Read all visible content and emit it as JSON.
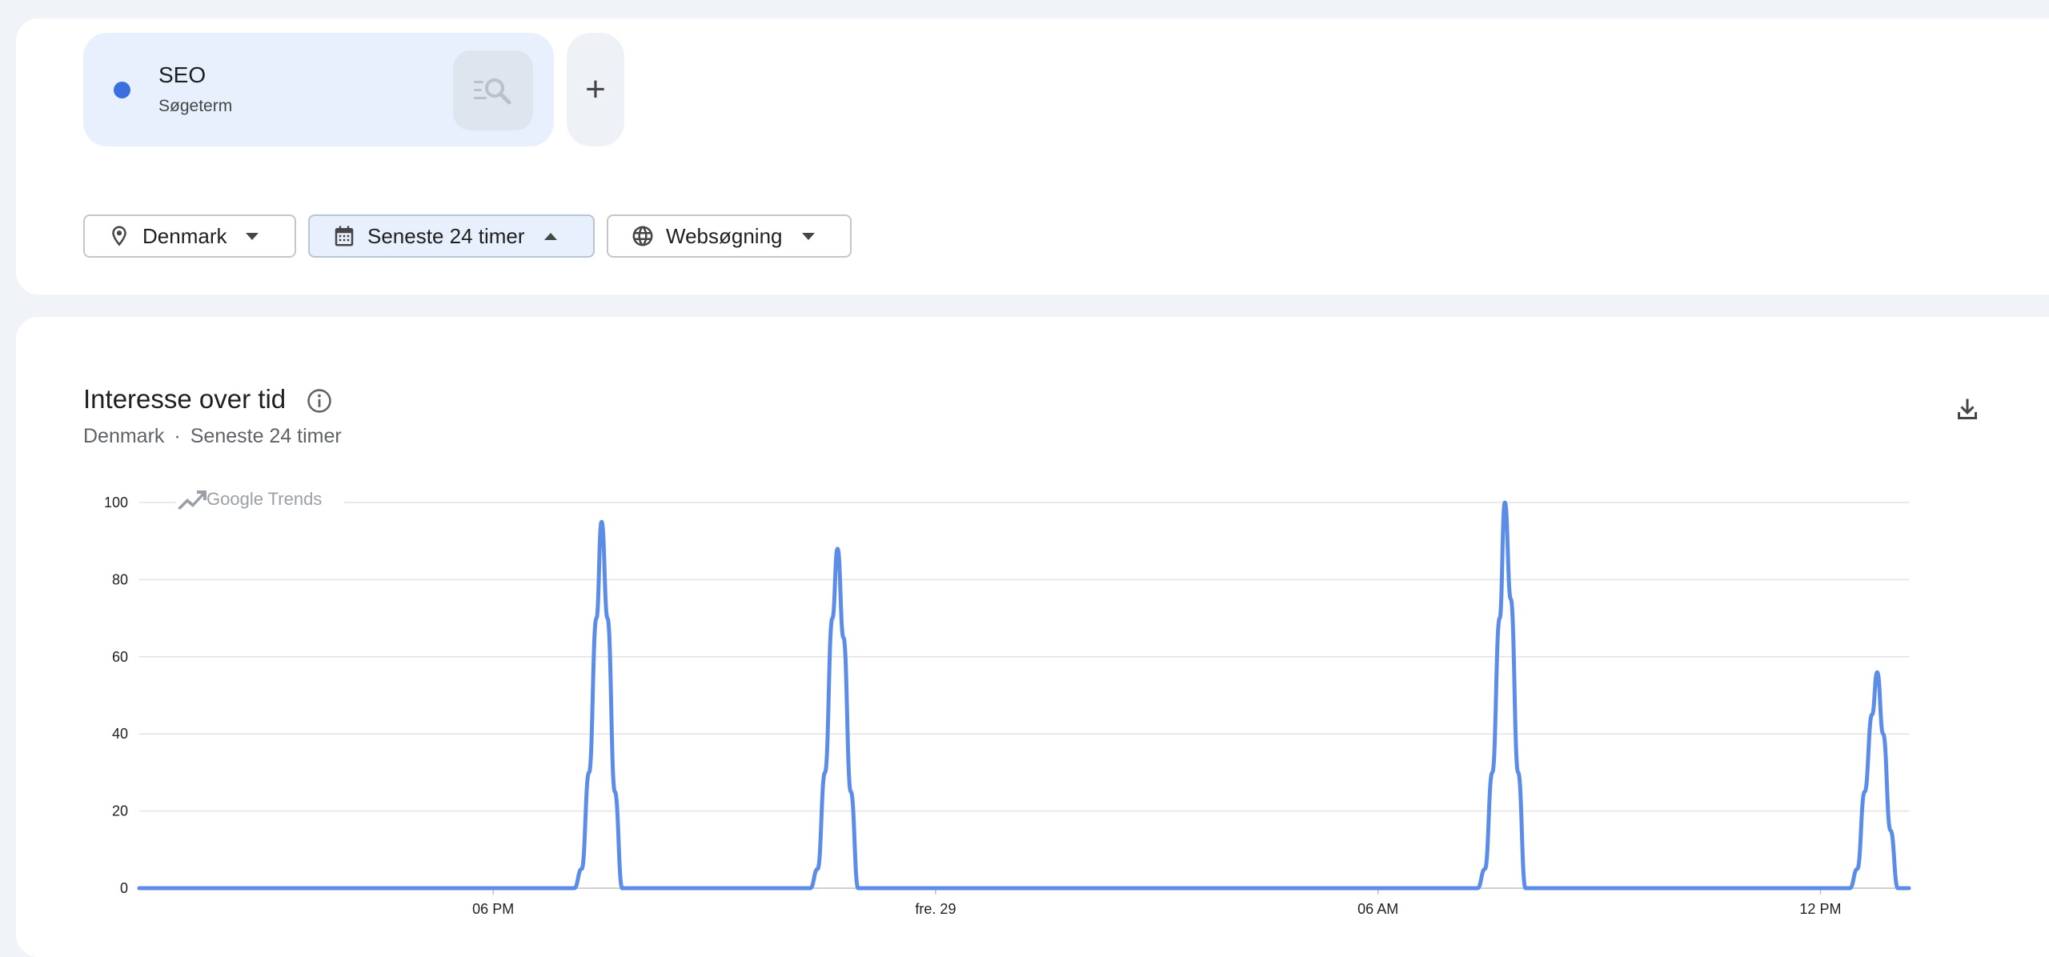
{
  "term": {
    "name": "SEO",
    "type": "Søgeterm",
    "color": "#3a6fe0",
    "search_icon": "search-list-icon",
    "add_label": "+"
  },
  "filters": {
    "location": {
      "label": "Denmark",
      "icon": "location-pin-icon"
    },
    "time": {
      "label": "Seneste 24 timer",
      "icon": "calendar-icon",
      "expanded": true
    },
    "type": {
      "label": "Websøgning",
      "icon": "globe-icon"
    }
  },
  "chart_card": {
    "title": "Interesse over tid",
    "subtitle_location": "Denmark",
    "subtitle_separator": "·",
    "subtitle_time": "Seneste 24 timer",
    "watermark": "Google Trends"
  },
  "chart_data": {
    "type": "line",
    "title": "Interesse over tid",
    "xlabel": "",
    "ylabel": "",
    "ylim": [
      0,
      100
    ],
    "yticks": [
      0,
      20,
      40,
      60,
      80,
      100
    ],
    "x_range_hours": [
      0,
      24
    ],
    "xticks": [
      {
        "label": "06 PM",
        "x": 4.8
      },
      {
        "label": "fre. 29",
        "x": 10.8
      },
      {
        "label": "06 AM",
        "x": 16.8
      },
      {
        "label": "12 PM",
        "x": 22.8
      }
    ],
    "grid": true,
    "legend": "none",
    "series": [
      {
        "color": "#5b8de8",
        "points": [
          [
            0.0,
            0
          ],
          [
            5.9,
            0
          ],
          [
            6.0,
            5
          ],
          [
            6.1,
            30
          ],
          [
            6.2,
            70
          ],
          [
            6.27,
            95
          ],
          [
            6.35,
            70
          ],
          [
            6.45,
            25
          ],
          [
            6.55,
            0
          ],
          [
            9.1,
            0
          ],
          [
            9.2,
            5
          ],
          [
            9.3,
            30
          ],
          [
            9.4,
            70
          ],
          [
            9.47,
            88
          ],
          [
            9.55,
            65
          ],
          [
            9.65,
            25
          ],
          [
            9.75,
            0
          ],
          [
            18.15,
            0
          ],
          [
            18.25,
            5
          ],
          [
            18.35,
            30
          ],
          [
            18.45,
            70
          ],
          [
            18.52,
            100
          ],
          [
            18.6,
            75
          ],
          [
            18.7,
            30
          ],
          [
            18.8,
            0
          ],
          [
            23.2,
            0
          ],
          [
            23.3,
            5
          ],
          [
            23.4,
            25
          ],
          [
            23.5,
            45
          ],
          [
            23.57,
            56
          ],
          [
            23.65,
            40
          ],
          [
            23.75,
            15
          ],
          [
            23.85,
            0
          ],
          [
            24.0,
            0
          ]
        ]
      }
    ]
  }
}
